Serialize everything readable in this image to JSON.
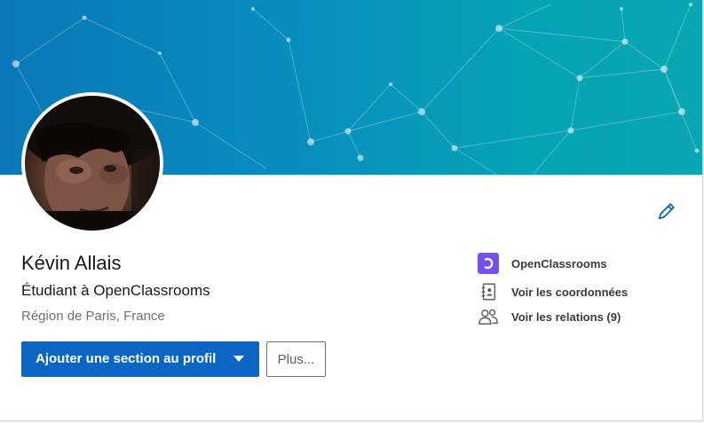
{
  "profile": {
    "name": "Kévin Allais",
    "headline": "Étudiant à OpenClassrooms",
    "location": "Région de Paris, France"
  },
  "actions": {
    "primary_label": "Ajouter une section au profil",
    "more_label": "Plus..."
  },
  "side": {
    "school": "OpenClassrooms",
    "contact": "Voir les coordonnées",
    "connections": "Voir les relations (9)"
  },
  "icons": {
    "edit": "pencil-icon",
    "school": "openclassrooms-logo-icon",
    "contact": "address-book-icon",
    "connections": "people-icon",
    "dropdown": "caret-down-icon"
  },
  "colors": {
    "primary": "#0a66c2",
    "banner_start": "#0a78b8",
    "banner_end": "#0aa6b2",
    "openclassrooms": "#7451eb"
  }
}
